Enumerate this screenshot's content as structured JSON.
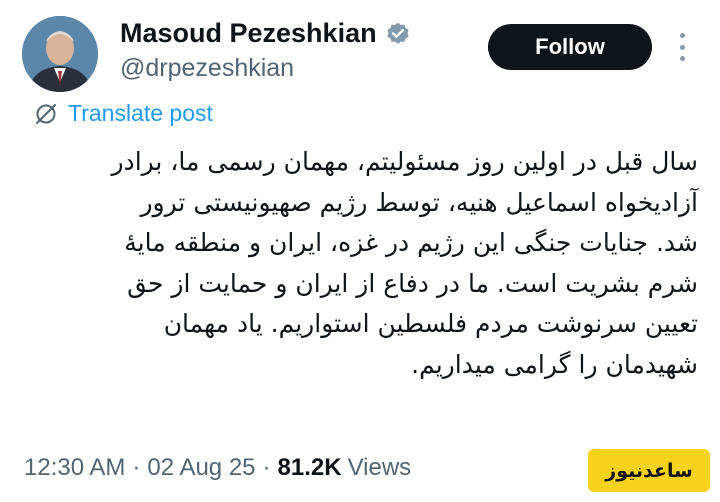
{
  "author": {
    "name": "Masoud Pezeshkian",
    "handle": "@drpezeshkian",
    "verified_icon": "verified-badge-icon",
    "avatar": "profile-photo"
  },
  "actions": {
    "follow_label": "Follow",
    "more_icon": "more-vertical-icon"
  },
  "translate": {
    "icon": "translate-globe-icon",
    "label": "Translate post"
  },
  "tweet": {
    "lines": [
      "سال قبل در اولین روز مسئولیتم، مهمان رسمی ما، برادر",
      "آزادیخواه اسماعیل هنیه، توسط رژیم صهیونیستی ترور",
      "شد. جنایات جنگی این رژیم در غزه، ایران و منطقه مایهٔ",
      "شرم بشریت است. ما در دفاع از ایران و حمایت از حق",
      "تعیین سرنوشت مردم فلسطین استواریم. یاد مهمان",
      "شهیدمان را گرامی میداریم."
    ]
  },
  "meta": {
    "time": "12:30 AM",
    "date": "02 Aug 25",
    "separator": "·",
    "views_count": "81.2K",
    "views_label": "Views"
  },
  "watermark": {
    "text": "ساعدنیوز"
  },
  "colors": {
    "text": "#0f1419",
    "secondary": "#536471",
    "link": "#1d9bf0",
    "button_bg": "#0f1419",
    "watermark_bg": "#f6d21a"
  }
}
